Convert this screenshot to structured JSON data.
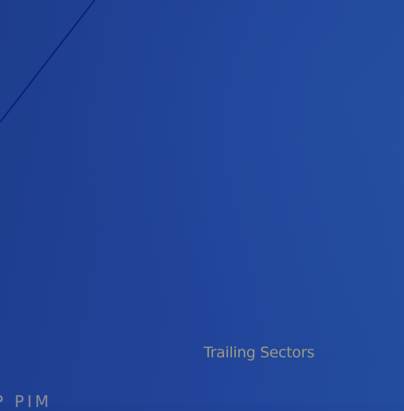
{
  "screen": {
    "sector_label": "Trailing Sectors",
    "bottom_text": "P  PIM"
  },
  "colors": {
    "background": "#21449a",
    "line": "#0d1f7a",
    "label": "#9c9a84"
  }
}
